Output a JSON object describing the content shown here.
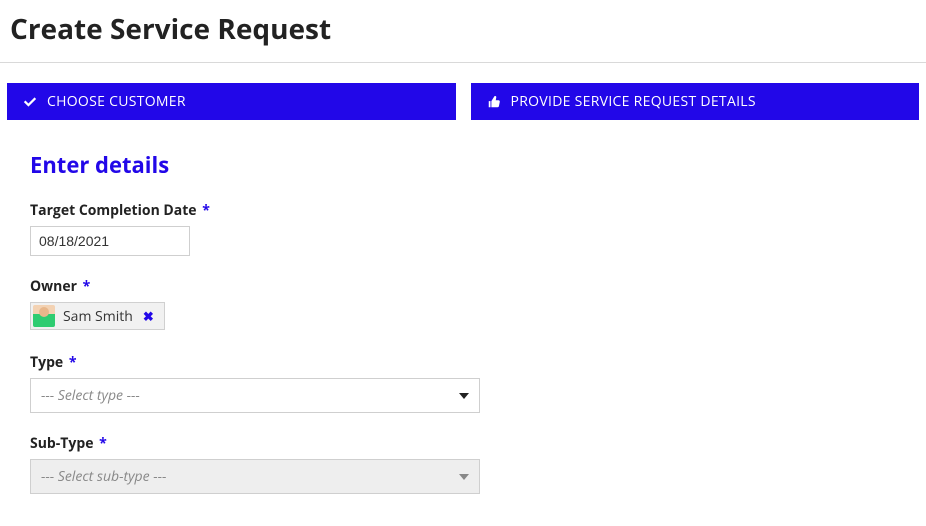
{
  "page": {
    "title": "Create Service Request"
  },
  "steps": {
    "choose_customer": "CHOOSE CUSTOMER",
    "provide_details": "PROVIDE SERVICE REQUEST DETAILS"
  },
  "form": {
    "section_title": "Enter details",
    "required_mark": "*",
    "target_date": {
      "label": "Target Completion Date",
      "value": "08/18/2021"
    },
    "owner": {
      "label": "Owner",
      "name": "Sam Smith",
      "remove_glyph": "✖"
    },
    "type": {
      "label": "Type",
      "placeholder": "--- Select type ---"
    },
    "subtype": {
      "label": "Sub-Type",
      "placeholder": "--- Select sub-type ---"
    }
  }
}
